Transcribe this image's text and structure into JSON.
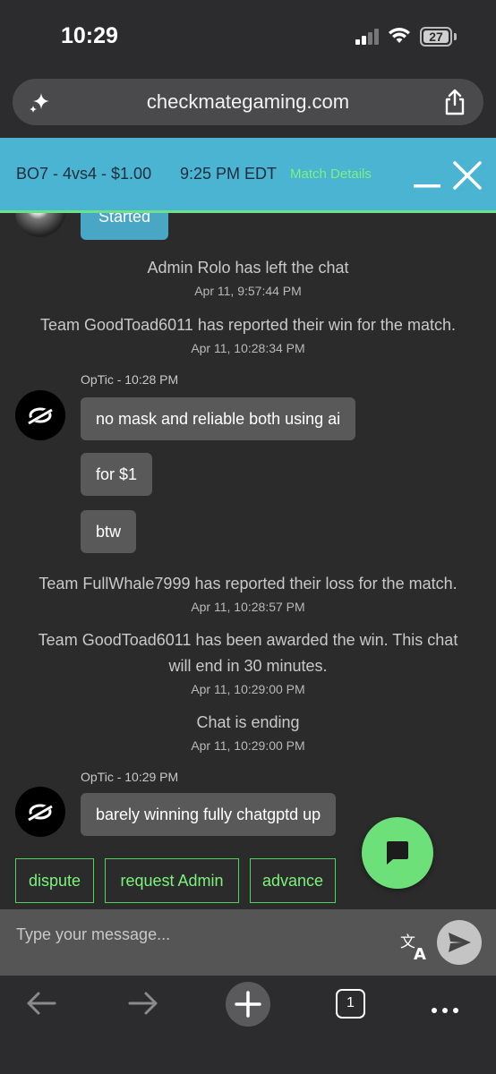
{
  "status_bar": {
    "time": "10:29",
    "battery": "27"
  },
  "browser": {
    "url": "checkmategaming.com",
    "tab_count": "1"
  },
  "match_header": {
    "title": "BO7 - 4vs4 - $1.00",
    "time": "9:25 PM EDT",
    "details_link": "Match Details"
  },
  "chat": {
    "partial_bubble": "Started",
    "events": [
      {
        "text": "Admin Rolo has left the chat",
        "timestamp": "Apr 11, 9:57:44 PM"
      },
      {
        "text": "Team GoodToad6011 has reported their win for the match.",
        "timestamp": "Apr 11, 10:28:34 PM"
      },
      {
        "text": "Team FullWhale7999 has reported their loss for the match.",
        "timestamp": "Apr 11, 10:28:57 PM"
      },
      {
        "line1": "Team GoodToad6011 has been awarded the win. This chat",
        "line2": "will end in 30 minutes.",
        "timestamp": "Apr 11, 10:29:00 PM"
      },
      {
        "text": "Chat is ending",
        "timestamp": "Apr 11, 10:29:00 PM"
      }
    ],
    "group1": {
      "sender": "OpTic - 10:28 PM",
      "messages": [
        "no mask and reliable both using ai",
        "for $1",
        "btw"
      ]
    },
    "group2": {
      "sender": "OpTic - 10:29 PM",
      "messages": [
        "barely winning fully chatgptd up"
      ]
    }
  },
  "actions": {
    "dispute": "dispute",
    "request_admin": "request Admin",
    "advance": "advance"
  },
  "input": {
    "placeholder": "Type your message..."
  },
  "colors": {
    "header_bg": "#4ab4d2",
    "accent_green": "#6de07a",
    "chat_bg": "#2b2b2b",
    "bubble_bg": "#595959"
  },
  "icons": {
    "sparkle": "sparkle-icon",
    "share": "share-icon",
    "minimize": "minimize-icon",
    "close": "close-icon",
    "chat_fab": "chat-bubble-icon",
    "translate": "translate-icon",
    "send": "send-icon",
    "back": "arrow-left-icon",
    "forward": "arrow-right-icon",
    "new_tab": "plus-icon",
    "more": "more-dots-icon"
  }
}
